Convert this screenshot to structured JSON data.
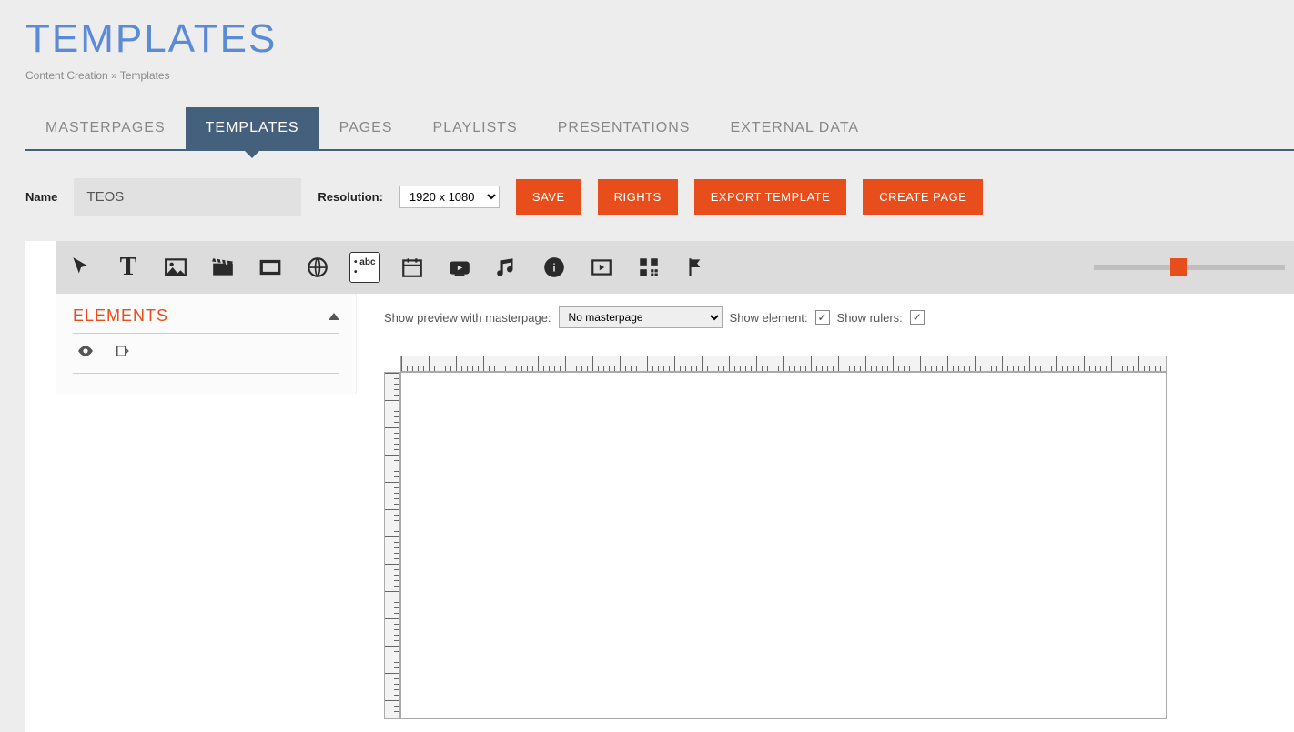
{
  "header": {
    "title": "TEMPLATES",
    "breadcrumb_parent": "Content Creation",
    "breadcrumb_sep": " » ",
    "breadcrumb_current": "Templates"
  },
  "tabs": {
    "masterpages": "MASTERPAGES",
    "templates": "TEMPLATES",
    "pages": "PAGES",
    "playlists": "PLAYLISTS",
    "presentations": "PRESENTATIONS",
    "external_data": "EXTERNAL DATA"
  },
  "form": {
    "name_label": "Name",
    "name_value": "TEOS",
    "resolution_label": "Resolution:",
    "resolution_value": "1920 x 1080"
  },
  "buttons": {
    "save": "SAVE",
    "rights": "RIGHTS",
    "export_template": "EXPORT TEMPLATE",
    "create_page": "CREATE PAGE"
  },
  "sidebar": {
    "title": "ELEMENTS"
  },
  "canvas_opts": {
    "preview_label": "Show preview with masterpage:",
    "masterpage_value": "No masterpage",
    "show_element_label": "Show element:",
    "show_rulers_label": "Show rulers:",
    "show_element_checked": true,
    "show_rulers_checked": true
  },
  "icons": {
    "pointer": "pointer-icon",
    "text": "T",
    "image": "image-icon",
    "video": "clapper-icon",
    "rect": "rectangle-icon",
    "web": "globe-icon",
    "marquee": "• abc •",
    "calendar": "calendar-icon",
    "youtube": "youtube-icon",
    "music": "music-icon",
    "badge": "badge-icon",
    "playback": "play-in-box-icon",
    "qr": "qr-icon",
    "flag": "flag-icon"
  },
  "colors": {
    "accent": "#e84e1c",
    "tab_active": "#44607d",
    "title": "#5a8ad8"
  }
}
